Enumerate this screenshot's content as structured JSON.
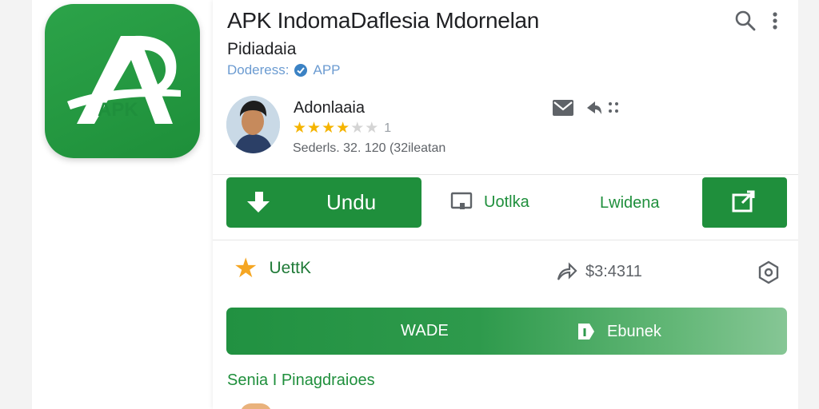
{
  "app": {
    "title": "APK IndomaDaflesia Mdornelan",
    "subtitle": "Pidiadaia",
    "developer_label": "Doderess:",
    "developer_badge": "APP",
    "icon": {
      "name": "apk-logo-icon",
      "text": "APK",
      "bg": "#1f8f3c"
    }
  },
  "toolbar": {
    "search_icon": "search-icon",
    "more_icon": "more-vert-icon"
  },
  "author": {
    "name": "Adonlaaia",
    "rating": 4,
    "rating_max": 6,
    "rating_count": "1",
    "meta": "Sederls. 32. 120 (32ileatan"
  },
  "actions": {
    "download_label": "Undu",
    "update_label": "Uotlka",
    "second_label": "Lwidena"
  },
  "info": {
    "rate_label": "UettK",
    "price": "$3:4311"
  },
  "bar": {
    "left_label": "WADE",
    "right_label": "Ebunek"
  },
  "section": {
    "title": "Senia I Pinagdraioes"
  },
  "colors": {
    "accent": "#1f8f3c",
    "star": "#f5b400",
    "link": "#6b9bd1"
  }
}
